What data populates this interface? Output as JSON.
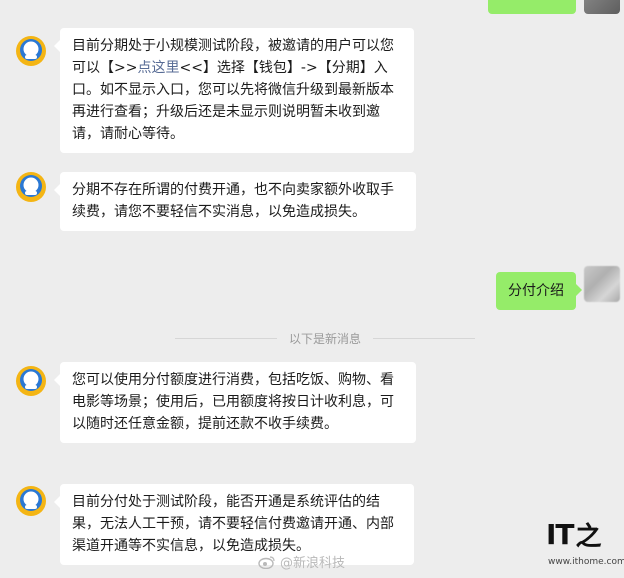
{
  "messages": [
    {
      "sender": "bot",
      "parts": {
        "a": "目前分期处于小规模测试阶段，被邀请的用户可以您可以【>>",
        "link": "点这里",
        "b": "<<】选择【钱包】->【分期】入口。如不显示入口，您可以先将微信升级到最新版本再进行查看；升级后还是未显示则说明暂未收到邀请，请耐心等待。"
      }
    },
    {
      "sender": "bot",
      "text": "分期不存在所谓的付费开通，也不向卖家额外收取手续费，请您不要轻信不实消息，以免造成损失。"
    },
    {
      "sender": "user",
      "text": "分付介绍"
    },
    {
      "sender": "bot",
      "text": "您可以使用分付额度进行消费，包括吃饭、购物、看电影等场景；使用后，已用额度将按日计收利息，可以随时还任意金额，提前还款不收手续费。"
    },
    {
      "sender": "bot",
      "text": "目前分付处于测试阶段，能否开通是系统评估的结果，无法人工干预，请不要轻信付费邀请开通、内部渠道开通等不实信息，以免造成损失。"
    }
  ],
  "divider_text": "以下是新消息",
  "watermark": {
    "text": "@新浪科技",
    "icon": "weibo-icon"
  },
  "logo": {
    "letters": "IT",
    "chinese": "之",
    "url": "www.ithome.com"
  },
  "colors": {
    "incoming_bubble": "#ffffff",
    "outgoing_bubble": "#95ec69",
    "background": "#ededed",
    "link": "#576b95"
  }
}
